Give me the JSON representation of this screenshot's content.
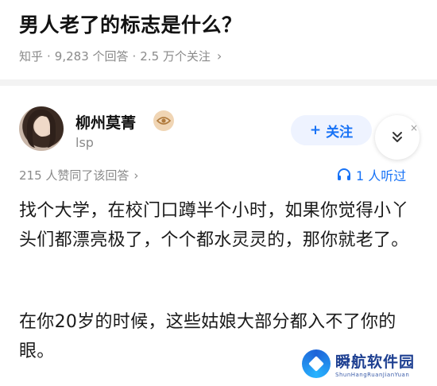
{
  "question": {
    "title": "男人老了的标志是什么？",
    "source": "知乎",
    "sep1": "·",
    "answers_count": "9,283 个回答",
    "sep2": "·",
    "followers": "2.5 万个关注",
    "chevron": "›"
  },
  "answer": {
    "author": {
      "name": "柳州莫菁",
      "subtitle": "lsp",
      "avatar_icon": "user-avatar-photo",
      "badge_icon": "eye-badge-icon"
    },
    "follow_button": {
      "plus": "+",
      "label": "关注"
    },
    "collapse_icon": "double-chevron-down-icon",
    "close_mark": "×",
    "upvote_text": "215 人赞同了该回答",
    "upvote_chevron": "›",
    "listen": {
      "icon": "headphones-icon",
      "label": "1 人听过"
    },
    "paragraphs": [
      "找个大学，在校门口蹲半个小时，如果你觉得小丫头们都漂亮极了，个个都水灵灵的，那你就老了。",
      "在你20岁的时候，这些姑娘大部分都入不了你的眼。"
    ]
  },
  "watermark": {
    "name": "瞬航软件园",
    "pinyin": "ShunHangRuanJianYuan"
  },
  "colors": {
    "accent": "#1772f6",
    "follow_bg": "#eef3ff",
    "muted_text": "#8a8a8a",
    "badge_bg": "#f0d5b4"
  }
}
